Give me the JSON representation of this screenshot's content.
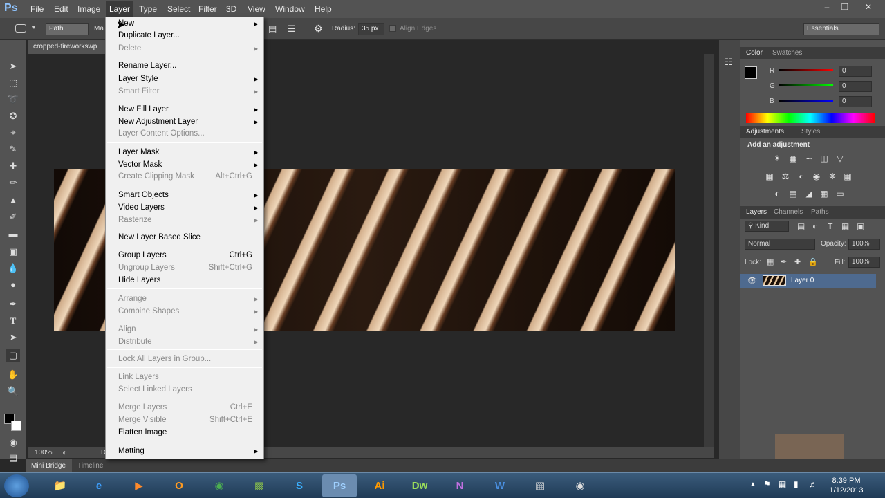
{
  "menubar": {
    "logo": "Ps",
    "items": [
      "File",
      "Edit",
      "Image",
      "Layer",
      "Type",
      "Select",
      "Filter",
      "3D",
      "View",
      "Window",
      "Help"
    ],
    "active": "Layer"
  },
  "options": {
    "tool_mode": "Path",
    "make_label": "Ma",
    "radius_label": "Radius:",
    "radius_value": "35 px",
    "align_edges": "Align Edges",
    "workspace": "Essentials"
  },
  "document": {
    "tab_title": "cropped-fireworkswp",
    "zoom": "100%",
    "status_extra": "D"
  },
  "layer_menu": {
    "items": [
      {
        "label": "New",
        "submenu": true,
        "disabled": false
      },
      {
        "label": "Duplicate Layer...",
        "disabled": false
      },
      {
        "label": "Delete",
        "submenu": true,
        "disabled": true
      },
      {
        "label": "Rename Layer...",
        "disabled": false
      },
      {
        "label": "Layer Style",
        "submenu": true,
        "disabled": false
      },
      {
        "label": "Smart Filter",
        "submenu": true,
        "disabled": true
      },
      {
        "label": "New Fill Layer",
        "submenu": true,
        "disabled": false
      },
      {
        "label": "New Adjustment Layer",
        "submenu": true,
        "disabled": false
      },
      {
        "label": "Layer Content Options...",
        "disabled": true
      },
      {
        "label": "Layer Mask",
        "submenu": true,
        "disabled": false
      },
      {
        "label": "Vector Mask",
        "submenu": true,
        "disabled": false
      },
      {
        "label": "Create Clipping Mask",
        "shortcut": "Alt+Ctrl+G",
        "disabled": true
      },
      {
        "label": "Smart Objects",
        "submenu": true,
        "disabled": false
      },
      {
        "label": "Video Layers",
        "submenu": true,
        "disabled": false
      },
      {
        "label": "Rasterize",
        "submenu": true,
        "disabled": true
      },
      {
        "label": "New Layer Based Slice",
        "disabled": false
      },
      {
        "label": "Group Layers",
        "shortcut": "Ctrl+G",
        "disabled": false
      },
      {
        "label": "Ungroup Layers",
        "shortcut": "Shift+Ctrl+G",
        "disabled": true
      },
      {
        "label": "Hide Layers",
        "disabled": false
      },
      {
        "label": "Arrange",
        "submenu": true,
        "disabled": true
      },
      {
        "label": "Combine Shapes",
        "submenu": true,
        "disabled": true
      },
      {
        "label": "Align",
        "submenu": true,
        "disabled": true
      },
      {
        "label": "Distribute",
        "submenu": true,
        "disabled": true
      },
      {
        "label": "Lock All Layers in Group...",
        "disabled": true
      },
      {
        "label": "Link Layers",
        "disabled": true
      },
      {
        "label": "Select Linked Layers",
        "disabled": true
      },
      {
        "label": "Merge Layers",
        "shortcut": "Ctrl+E",
        "disabled": true
      },
      {
        "label": "Merge Visible",
        "shortcut": "Shift+Ctrl+E",
        "disabled": true
      },
      {
        "label": "Flatten Image",
        "disabled": false
      },
      {
        "label": "Matting",
        "submenu": true,
        "disabled": false
      }
    ]
  },
  "color_panel": {
    "tabs": [
      "Color",
      "Swatches"
    ],
    "channels": [
      {
        "name": "R",
        "value": "0"
      },
      {
        "name": "G",
        "value": "0"
      },
      {
        "name": "B",
        "value": "0"
      }
    ]
  },
  "adjustments_panel": {
    "tabs": [
      "Adjustments",
      "Styles"
    ],
    "heading": "Add an adjustment"
  },
  "layers_panel": {
    "tabs": [
      "Layers",
      "Channels",
      "Paths"
    ],
    "filter": "Kind",
    "blend_mode": "Normal",
    "opacity_label": "Opacity:",
    "opacity": "100%",
    "lock_label": "Lock:",
    "fill_label": "Fill:",
    "fill": "100%",
    "layers": [
      {
        "name": "Layer 0"
      }
    ]
  },
  "bottom_tabs": [
    "Mini Bridge",
    "Timeline"
  ],
  "taskbar": {
    "apps": [
      "Ps",
      "Ai",
      "Dw",
      "N",
      "W"
    ],
    "time": "8:39 PM",
    "date": "1/12/2013"
  },
  "colors": {
    "accent_ps": "#8fc4ff",
    "selected_layer": "#4e6a8f"
  }
}
